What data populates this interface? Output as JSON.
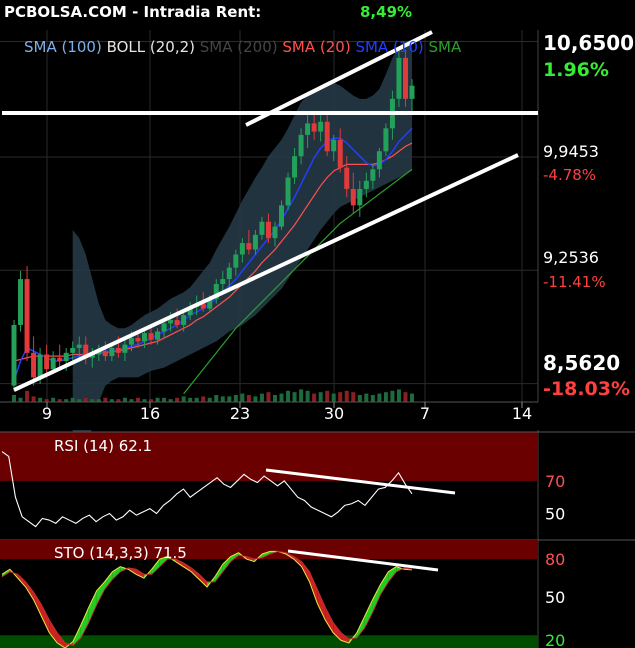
{
  "header": {
    "ticker": "PCBOLSA.COM",
    "separator": "-",
    "mode": "Intradia",
    "rent_label": "Rent:",
    "rent_value": "8,49%"
  },
  "legend": [
    {
      "label": "SMA (100)",
      "color": "#7fb0e8"
    },
    {
      "label": "BOLL (20,2)",
      "color": "#e6e6e6"
    },
    {
      "label": "SMA (200)",
      "color": "#444444"
    },
    {
      "label": "SMA (20)",
      "color": "#ff5050"
    },
    {
      "label": "SMA (10)",
      "color": "#2040ff"
    },
    {
      "label": "SMA",
      "color": "#2aa02a"
    }
  ],
  "right_axis": [
    {
      "price": "10,6500",
      "pct": "1.96%",
      "pct_color": "#33ee33",
      "emphasis": true
    },
    {
      "price": "9,9453",
      "pct": "-4.78%",
      "pct_color": "#ff4040",
      "emphasis": false
    },
    {
      "price": "9,2536",
      "pct": "-11.41%",
      "pct_color": "#ff4040",
      "emphasis": false
    },
    {
      "price": "8,5620",
      "pct": "-18.03%",
      "pct_color": "#ff4040",
      "emphasis": true
    }
  ],
  "x_ticks": [
    "9",
    "16",
    "23",
    "30",
    "7",
    "14"
  ],
  "rsi": {
    "label": "RSI (14) 62.1",
    "levels": [
      "70",
      "50"
    ],
    "overbought_color": "#6b0000"
  },
  "sto": {
    "label": "STO (14,3,3) 71.5",
    "levels": [
      "80",
      "50",
      "20"
    ],
    "overbought_color": "#6b0000",
    "oversold_color": "#004d00"
  },
  "colors": {
    "up": "#23a15a",
    "down": "#e03a3a",
    "bands": "#243846",
    "trendline": "#ffffff"
  },
  "chart_data": {
    "type": "candlestick",
    "price_ticks": [
      10.65,
      9.9453,
      9.2536,
      8.562
    ],
    "ylim": [
      8.45,
      10.72
    ],
    "x_tick_labels": [
      "9",
      "16",
      "23",
      "30",
      "7",
      "14"
    ],
    "candles": [
      [
        8.55,
        8.95,
        8.52,
        8.92
      ],
      [
        8.92,
        9.25,
        8.88,
        9.2
      ],
      [
        9.2,
        9.28,
        8.7,
        8.75
      ],
      [
        8.75,
        8.85,
        8.55,
        8.6
      ],
      [
        8.6,
        8.78,
        8.56,
        8.74
      ],
      [
        8.74,
        8.8,
        8.6,
        8.65
      ],
      [
        8.65,
        8.76,
        8.62,
        8.72
      ],
      [
        8.72,
        8.8,
        8.66,
        8.7
      ],
      [
        8.7,
        8.78,
        8.64,
        8.75
      ],
      [
        8.75,
        8.82,
        8.7,
        8.78
      ],
      [
        8.78,
        8.85,
        8.72,
        8.8
      ],
      [
        8.8,
        8.85,
        8.68,
        8.72
      ],
      [
        8.72,
        8.78,
        8.66,
        8.74
      ],
      [
        8.74,
        8.8,
        8.7,
        8.76
      ],
      [
        8.76,
        8.82,
        8.7,
        8.73
      ],
      [
        8.73,
        8.8,
        8.7,
        8.78
      ],
      [
        8.78,
        8.85,
        8.72,
        8.75
      ],
      [
        8.75,
        8.83,
        8.7,
        8.8
      ],
      [
        8.8,
        8.88,
        8.76,
        8.84
      ],
      [
        8.84,
        8.88,
        8.78,
        8.82
      ],
      [
        8.82,
        8.9,
        8.78,
        8.87
      ],
      [
        8.87,
        8.92,
        8.8,
        8.83
      ],
      [
        8.83,
        8.9,
        8.8,
        8.88
      ],
      [
        8.88,
        8.96,
        8.84,
        8.93
      ],
      [
        8.93,
        9.0,
        8.88,
        8.95
      ],
      [
        8.95,
        9.02,
        8.9,
        8.92
      ],
      [
        8.92,
        9.0,
        8.88,
        8.98
      ],
      [
        8.98,
        9.06,
        8.95,
        9.03
      ],
      [
        9.03,
        9.1,
        8.98,
        9.05
      ],
      [
        9.05,
        9.12,
        9.0,
        9.02
      ],
      [
        9.02,
        9.1,
        9.0,
        9.08
      ],
      [
        9.08,
        9.2,
        9.05,
        9.17
      ],
      [
        9.17,
        9.25,
        9.12,
        9.2
      ],
      [
        9.2,
        9.3,
        9.15,
        9.27
      ],
      [
        9.27,
        9.38,
        9.22,
        9.35
      ],
      [
        9.35,
        9.45,
        9.3,
        9.42
      ],
      [
        9.42,
        9.5,
        9.35,
        9.38
      ],
      [
        9.38,
        9.5,
        9.35,
        9.47
      ],
      [
        9.47,
        9.58,
        9.44,
        9.55
      ],
      [
        9.55,
        9.6,
        9.42,
        9.45
      ],
      [
        9.45,
        9.55,
        9.4,
        9.52
      ],
      [
        9.52,
        9.68,
        9.5,
        9.65
      ],
      [
        9.65,
        9.85,
        9.62,
        9.82
      ],
      [
        9.82,
        10.0,
        9.78,
        9.95
      ],
      [
        9.95,
        10.12,
        9.9,
        10.08
      ],
      [
        10.08,
        10.2,
        10.0,
        10.15
      ],
      [
        10.15,
        10.22,
        10.05,
        10.1
      ],
      [
        10.1,
        10.2,
        10.04,
        10.16
      ],
      [
        10.16,
        10.2,
        9.95,
        9.98
      ],
      [
        9.98,
        10.08,
        9.92,
        10.05
      ],
      [
        10.05,
        10.12,
        9.85,
        9.88
      ],
      [
        9.88,
        9.95,
        9.7,
        9.75
      ],
      [
        9.75,
        9.85,
        9.6,
        9.65
      ],
      [
        9.65,
        9.8,
        9.58,
        9.75
      ],
      [
        9.75,
        9.85,
        9.7,
        9.8
      ],
      [
        9.8,
        9.9,
        9.75,
        9.87
      ],
      [
        9.87,
        10.0,
        9.82,
        9.98
      ],
      [
        9.98,
        10.15,
        9.95,
        10.12
      ],
      [
        10.12,
        10.35,
        10.05,
        10.3
      ],
      [
        10.3,
        10.62,
        10.25,
        10.55
      ],
      [
        10.55,
        10.6,
        10.25,
        10.3
      ],
      [
        10.3,
        10.42,
        10.2,
        10.38
      ]
    ],
    "sma10": [
      8.58,
      8.7,
      8.78,
      8.76,
      8.74,
      8.72,
      8.7,
      8.7,
      8.71,
      8.72,
      8.73,
      8.74,
      8.74,
      8.75,
      8.76,
      8.76,
      8.77,
      8.78,
      8.79,
      8.8,
      8.82,
      8.84,
      8.86,
      8.88,
      8.9,
      8.92,
      8.95,
      8.98,
      9.0,
      9.02,
      9.05,
      9.08,
      9.12,
      9.16,
      9.2,
      9.25,
      9.3,
      9.35,
      9.4,
      9.45,
      9.5,
      9.56,
      9.63,
      9.7,
      9.78,
      9.86,
      9.94,
      10.0,
      10.04,
      10.06,
      10.06,
      10.03,
      9.99,
      9.95,
      9.91,
      9.89,
      9.9,
      9.93,
      9.98,
      10.04,
      10.08,
      10.12
    ],
    "sma20": [
      8.7,
      8.71,
      8.72,
      8.73,
      8.73,
      8.73,
      8.73,
      8.73,
      8.73,
      8.74,
      8.74,
      8.74,
      8.75,
      8.75,
      8.75,
      8.76,
      8.76,
      8.77,
      8.78,
      8.79,
      8.8,
      8.81,
      8.82,
      8.84,
      8.86,
      8.88,
      8.9,
      8.92,
      8.95,
      8.97,
      9.0,
      9.03,
      9.06,
      9.09,
      9.13,
      9.17,
      9.21,
      9.25,
      9.3,
      9.34,
      9.38,
      9.43,
      9.48,
      9.53,
      9.59,
      9.65,
      9.71,
      9.77,
      9.82,
      9.86,
      9.88,
      9.9,
      9.9,
      9.9,
      9.9,
      9.9,
      9.91,
      9.93,
      9.95,
      9.98,
      10.01,
      10.03
    ],
    "sma_long": [
      null,
      null,
      null,
      null,
      null,
      null,
      null,
      null,
      null,
      null,
      null,
      null,
      null,
      null,
      null,
      null,
      null,
      null,
      null,
      null,
      null,
      null,
      null,
      null,
      null,
      null,
      8.5,
      8.55,
      8.6,
      8.65,
      8.7,
      8.75,
      8.8,
      8.85,
      8.9,
      8.94,
      8.98,
      9.02,
      9.06,
      9.1,
      9.14,
      9.18,
      9.22,
      9.26,
      9.3,
      9.34,
      9.38,
      9.42,
      9.46,
      9.5,
      9.54,
      9.57,
      9.6,
      9.63,
      9.66,
      9.69,
      9.72,
      9.75,
      9.78,
      9.81,
      9.84,
      9.87
    ],
    "boll_upper": [
      null,
      null,
      null,
      null,
      null,
      null,
      null,
      null,
      null,
      9.5,
      9.45,
      9.35,
      9.2,
      9.05,
      8.95,
      8.92,
      8.9,
      8.9,
      8.92,
      8.95,
      8.98,
      9.0,
      9.02,
      9.05,
      9.08,
      9.1,
      9.12,
      9.15,
      9.2,
      9.25,
      9.3,
      9.38,
      9.45,
      9.52,
      9.6,
      9.68,
      9.75,
      9.82,
      9.88,
      9.95,
      10.0,
      10.05,
      10.12,
      10.2,
      10.28,
      10.32,
      10.35,
      10.38,
      10.4,
      10.4,
      10.38,
      10.35,
      10.32,
      10.3,
      10.3,
      10.32,
      10.36,
      10.45,
      10.55,
      10.62,
      10.65,
      10.66
    ],
    "boll_lower": [
      null,
      null,
      null,
      null,
      null,
      null,
      null,
      null,
      null,
      8.0,
      8.05,
      8.15,
      8.3,
      8.45,
      8.55,
      8.58,
      8.6,
      8.6,
      8.6,
      8.6,
      8.62,
      8.64,
      8.65,
      8.66,
      8.68,
      8.7,
      8.72,
      8.74,
      8.76,
      8.78,
      8.8,
      8.82,
      8.85,
      8.88,
      8.9,
      8.92,
      8.95,
      8.98,
      9.02,
      9.06,
      9.1,
      9.14,
      9.2,
      9.26,
      9.32,
      9.38,
      9.44,
      9.5,
      9.55,
      9.6,
      9.64,
      9.66,
      9.68,
      9.7,
      9.72,
      9.74,
      9.76,
      9.78,
      9.8,
      9.82,
      9.84,
      9.86
    ],
    "volume": [
      0.5,
      0.3,
      0.8,
      0.4,
      0.3,
      0.2,
      0.3,
      0.2,
      0.2,
      0.3,
      0.2,
      0.3,
      0.2,
      0.2,
      0.3,
      0.2,
      0.2,
      0.3,
      0.2,
      0.3,
      0.2,
      0.2,
      0.3,
      0.3,
      0.2,
      0.3,
      0.4,
      0.3,
      0.3,
      0.4,
      0.3,
      0.5,
      0.4,
      0.4,
      0.5,
      0.6,
      0.5,
      0.4,
      0.6,
      0.7,
      0.5,
      0.6,
      0.8,
      0.7,
      0.9,
      0.8,
      0.6,
      0.7,
      0.8,
      0.6,
      0.7,
      0.8,
      0.7,
      0.5,
      0.6,
      0.5,
      0.6,
      0.7,
      0.8,
      0.9,
      0.7,
      0.6
    ],
    "rsi": [
      88,
      85,
      60,
      48,
      45,
      42,
      47,
      46,
      44,
      48,
      46,
      44,
      47,
      49,
      45,
      48,
      50,
      46,
      48,
      52,
      49,
      51,
      53,
      50,
      55,
      58,
      62,
      65,
      60,
      63,
      66,
      69,
      72,
      68,
      66,
      70,
      74,
      71,
      69,
      73,
      70,
      67,
      70,
      65,
      60,
      58,
      54,
      52,
      50,
      48,
      51,
      55,
      56,
      58,
      55,
      60,
      65,
      66,
      70,
      75,
      68,
      62.1
    ],
    "sto_k": [
      68,
      72,
      65,
      58,
      48,
      35,
      22,
      14,
      10,
      15,
      28,
      42,
      55,
      62,
      70,
      74,
      72,
      68,
      65,
      72,
      80,
      82,
      78,
      74,
      70,
      64,
      58,
      66,
      76,
      82,
      85,
      80,
      78,
      84,
      86,
      86,
      84,
      80,
      74,
      62,
      45,
      32,
      22,
      16,
      14,
      22,
      35,
      48,
      60,
      70,
      74,
      72,
      71.5
    ],
    "sto_d": [
      66,
      70,
      68,
      62,
      54,
      44,
      32,
      22,
      14,
      12,
      18,
      30,
      44,
      56,
      64,
      70,
      73,
      72,
      68,
      68,
      74,
      80,
      80,
      77,
      73,
      68,
      62,
      62,
      70,
      78,
      83,
      82,
      80,
      81,
      84,
      86,
      85,
      82,
      78,
      70,
      56,
      42,
      30,
      22,
      17,
      18,
      26,
      38,
      52,
      62,
      70,
      73,
      72
    ]
  }
}
